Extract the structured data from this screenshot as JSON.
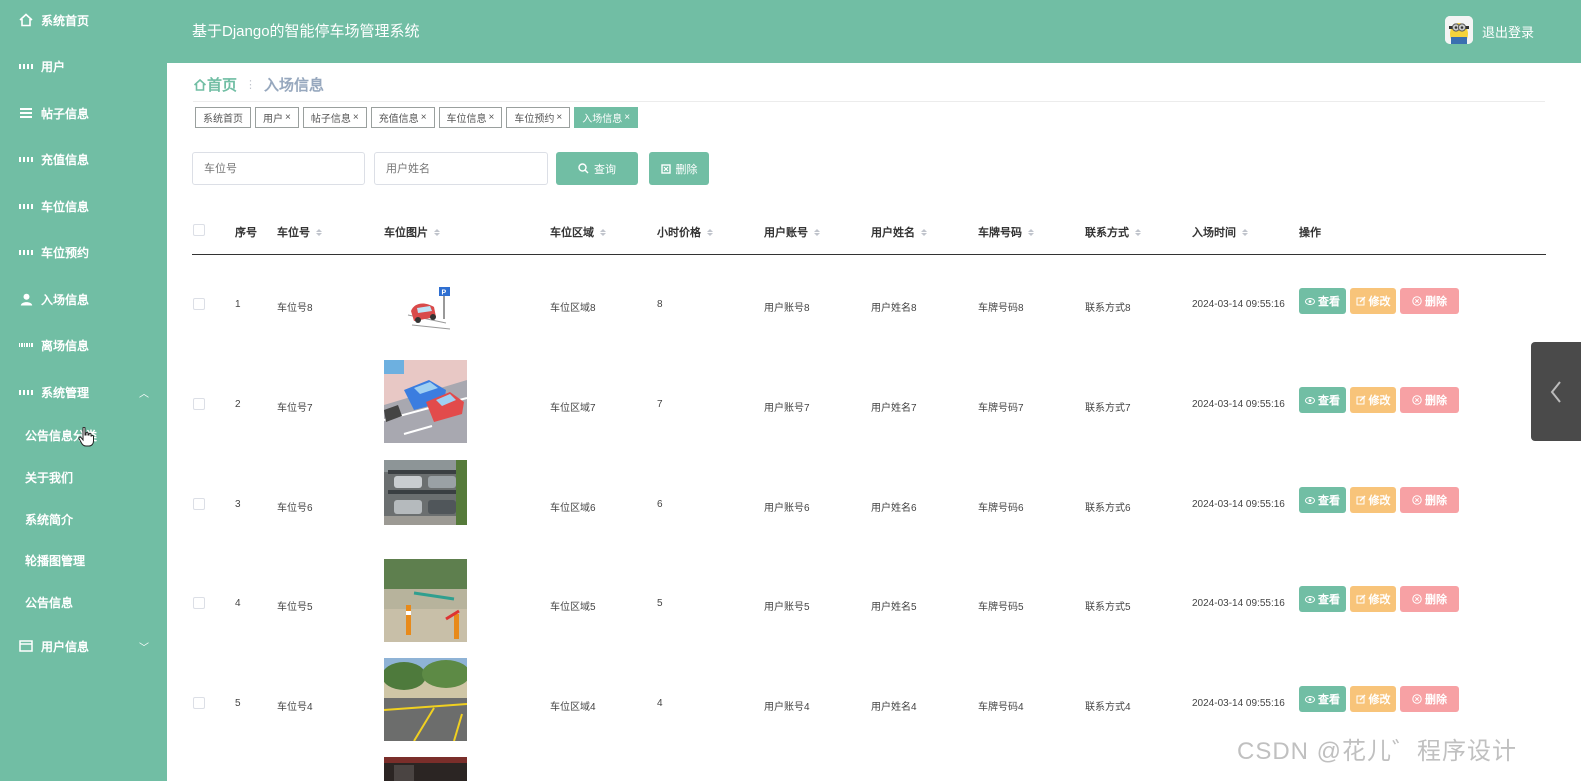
{
  "header": {
    "title": "基于Django的智能停车场管理系统",
    "logout": "退出登录"
  },
  "sidebar": {
    "items": [
      {
        "label": "系统首页",
        "icon": "home-icon"
      },
      {
        "label": "用户",
        "icon": "grid-icon"
      },
      {
        "label": "帖子信息",
        "icon": "list-icon"
      },
      {
        "label": "充值信息",
        "icon": "grid-icon"
      },
      {
        "label": "车位信息",
        "icon": "grid-icon"
      },
      {
        "label": "车位预约",
        "icon": "grid-icon"
      },
      {
        "label": "入场信息",
        "icon": "user-icon"
      },
      {
        "label": "离场信息",
        "icon": "grid9-icon"
      },
      {
        "label": "系统管理",
        "icon": "grid-icon"
      }
    ],
    "sub_items": [
      {
        "label": "公告信息分类"
      },
      {
        "label": "关于我们"
      },
      {
        "label": "系统简介"
      },
      {
        "label": "轮播图管理"
      },
      {
        "label": "公告信息"
      }
    ],
    "user_info": "用户信息"
  },
  "breadcrumb": {
    "home": "首页",
    "current": "入场信息"
  },
  "tags": [
    {
      "label": "系统首页",
      "closable": false
    },
    {
      "label": "用户",
      "closable": true
    },
    {
      "label": "帖子信息",
      "closable": true
    },
    {
      "label": "充值信息",
      "closable": true
    },
    {
      "label": "车位信息",
      "closable": true
    },
    {
      "label": "车位预约",
      "closable": true
    },
    {
      "label": "入场信息",
      "closable": true,
      "active": true
    }
  ],
  "search": {
    "spot_placeholder": "车位号",
    "name_placeholder": "用户姓名",
    "query_label": "查询",
    "delete_label": "删除"
  },
  "table": {
    "columns": [
      "序号",
      "车位号",
      "车位图片",
      "车位区域",
      "小时价格",
      "用户账号",
      "用户姓名",
      "车牌号码",
      "联系方式",
      "入场时间",
      "操作"
    ],
    "actions": {
      "view": "查看",
      "edit": "修改",
      "delete": "删除"
    },
    "rows": [
      {
        "no": "1",
        "spot": "车位号8",
        "area": "车位区域8",
        "price": "8",
        "account": "用户账号8",
        "name": "用户姓名8",
        "plate": "车牌号码8",
        "contact": "联系方式8",
        "time": "2024-03-14 09:55:16"
      },
      {
        "no": "2",
        "spot": "车位号7",
        "area": "车位区域7",
        "price": "7",
        "account": "用户账号7",
        "name": "用户姓名7",
        "plate": "车牌号码7",
        "contact": "联系方式7",
        "time": "2024-03-14 09:55:16"
      },
      {
        "no": "3",
        "spot": "车位号6",
        "area": "车位区域6",
        "price": "6",
        "account": "用户账号6",
        "name": "用户姓名6",
        "plate": "车牌号码6",
        "contact": "联系方式6",
        "time": "2024-03-14 09:55:16"
      },
      {
        "no": "4",
        "spot": "车位号5",
        "area": "车位区域5",
        "price": "5",
        "account": "用户账号5",
        "name": "用户姓名5",
        "plate": "车牌号码5",
        "contact": "联系方式5",
        "time": "2024-03-14 09:55:16"
      },
      {
        "no": "5",
        "spot": "车位号4",
        "area": "车位区域4",
        "price": "4",
        "account": "用户账号4",
        "name": "用户姓名4",
        "plate": "车牌号码4",
        "contact": "联系方式4",
        "time": "2024-03-14 09:55:16"
      }
    ]
  },
  "watermark": "CSDN @花儿゛程序设计",
  "colors": {
    "primary": "#71bea4",
    "edit": "#f8c47a",
    "delete": "#f7a1a4"
  }
}
